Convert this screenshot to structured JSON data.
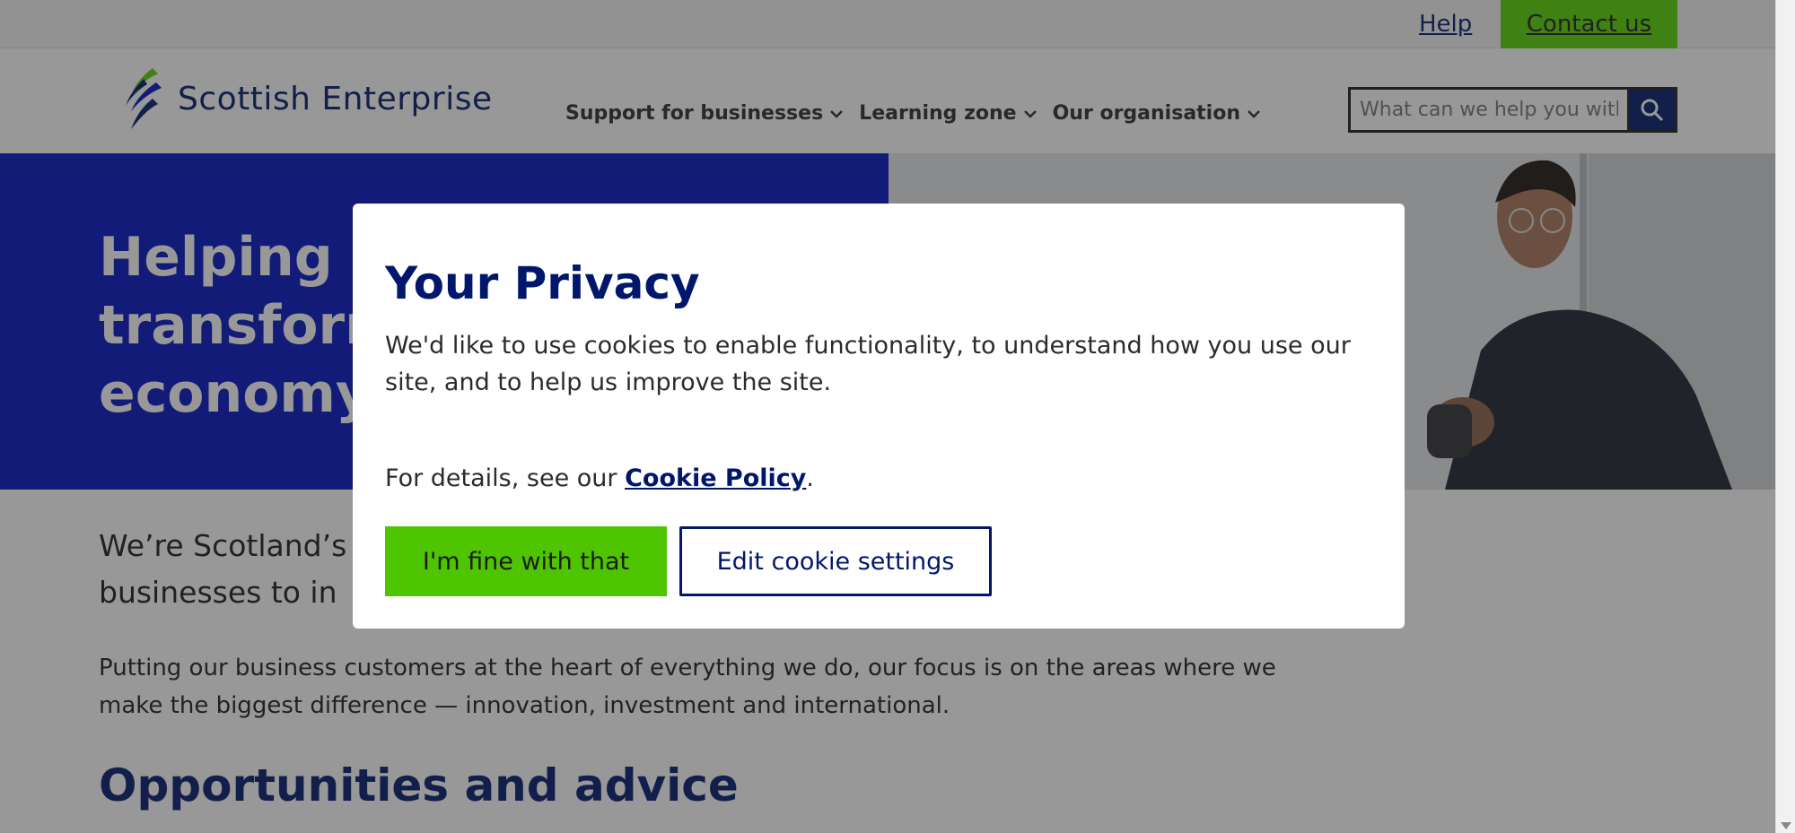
{
  "utility": {
    "help_label": "Help",
    "contact_label": "Contact us"
  },
  "header": {
    "logo_text": "Scottish Enterprise",
    "nav": [
      {
        "label": "Support for businesses"
      },
      {
        "label": "Learning zone"
      },
      {
        "label": "Our organisation"
      }
    ],
    "search_placeholder": "What can we help you with?"
  },
  "hero": {
    "title_line1": "Helping b",
    "title_line2": "transform",
    "title_line3": "economy"
  },
  "content": {
    "intro_line1": "We’re Scotland’s",
    "intro_line2": "businesses to in",
    "paragraph": "Putting our business customers at the heart of everything we do, our focus is on the areas where we make the biggest difference — innovation, investment and international.",
    "section_title": "Opportunities and advice"
  },
  "cookie_modal": {
    "title": "Your Privacy",
    "text": "We'd like to use cookies to enable functionality, to understand how you use our site, and to help us improve the site.",
    "details_prefix": "For details, see our ",
    "policy_link": "Cookie Policy",
    "details_suffix": ".",
    "accept_label": "I'm fine with that",
    "edit_label": "Edit cookie settings"
  },
  "colors": {
    "brand_navy": "#00176b",
    "hero_blue": "#0010c4",
    "accent_green": "#56d400"
  }
}
